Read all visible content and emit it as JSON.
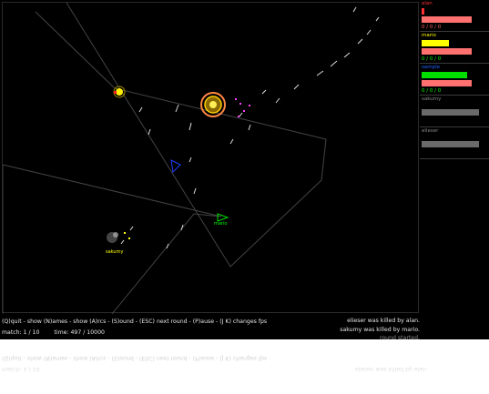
{
  "hud": {
    "controls": "(Q)quit - show (N)ames - show (A)rcs - (S)ound - (ESC) next round - (P)ause - (J K) changes fps",
    "match": "match: 1 / 10",
    "time": "time: 497 / 10000"
  },
  "log": [
    "elieser was killed by alan.",
    "sakumy was killed by mario.",
    "round started."
  ],
  "players": [
    {
      "name": "alan",
      "color": "#ff3030",
      "energy": 0.05,
      "score": "0 / 0 / 0",
      "alive": true
    },
    {
      "name": "mario",
      "color": "#ffff00",
      "energy": 0.55,
      "score": "0 / 0 / 0",
      "alive": true
    },
    {
      "name": "sample",
      "color": "#2060ff",
      "energy": 0.9,
      "score": "0 / 0 / 0",
      "alive": true
    },
    {
      "name": "sakumy",
      "color": "#888888",
      "energy": 0.9,
      "score": "",
      "alive": false
    },
    {
      "name": "elieser",
      "color": "#888888",
      "energy": 0.9,
      "score": "",
      "alive": false
    }
  ],
  "bots": {
    "mario": "mario",
    "sakumy": "sakumy"
  },
  "colors": {
    "background": "#000000",
    "health": "#ff7070",
    "dead_bar": "#6a6a6a",
    "energy_green": "#00e000"
  }
}
